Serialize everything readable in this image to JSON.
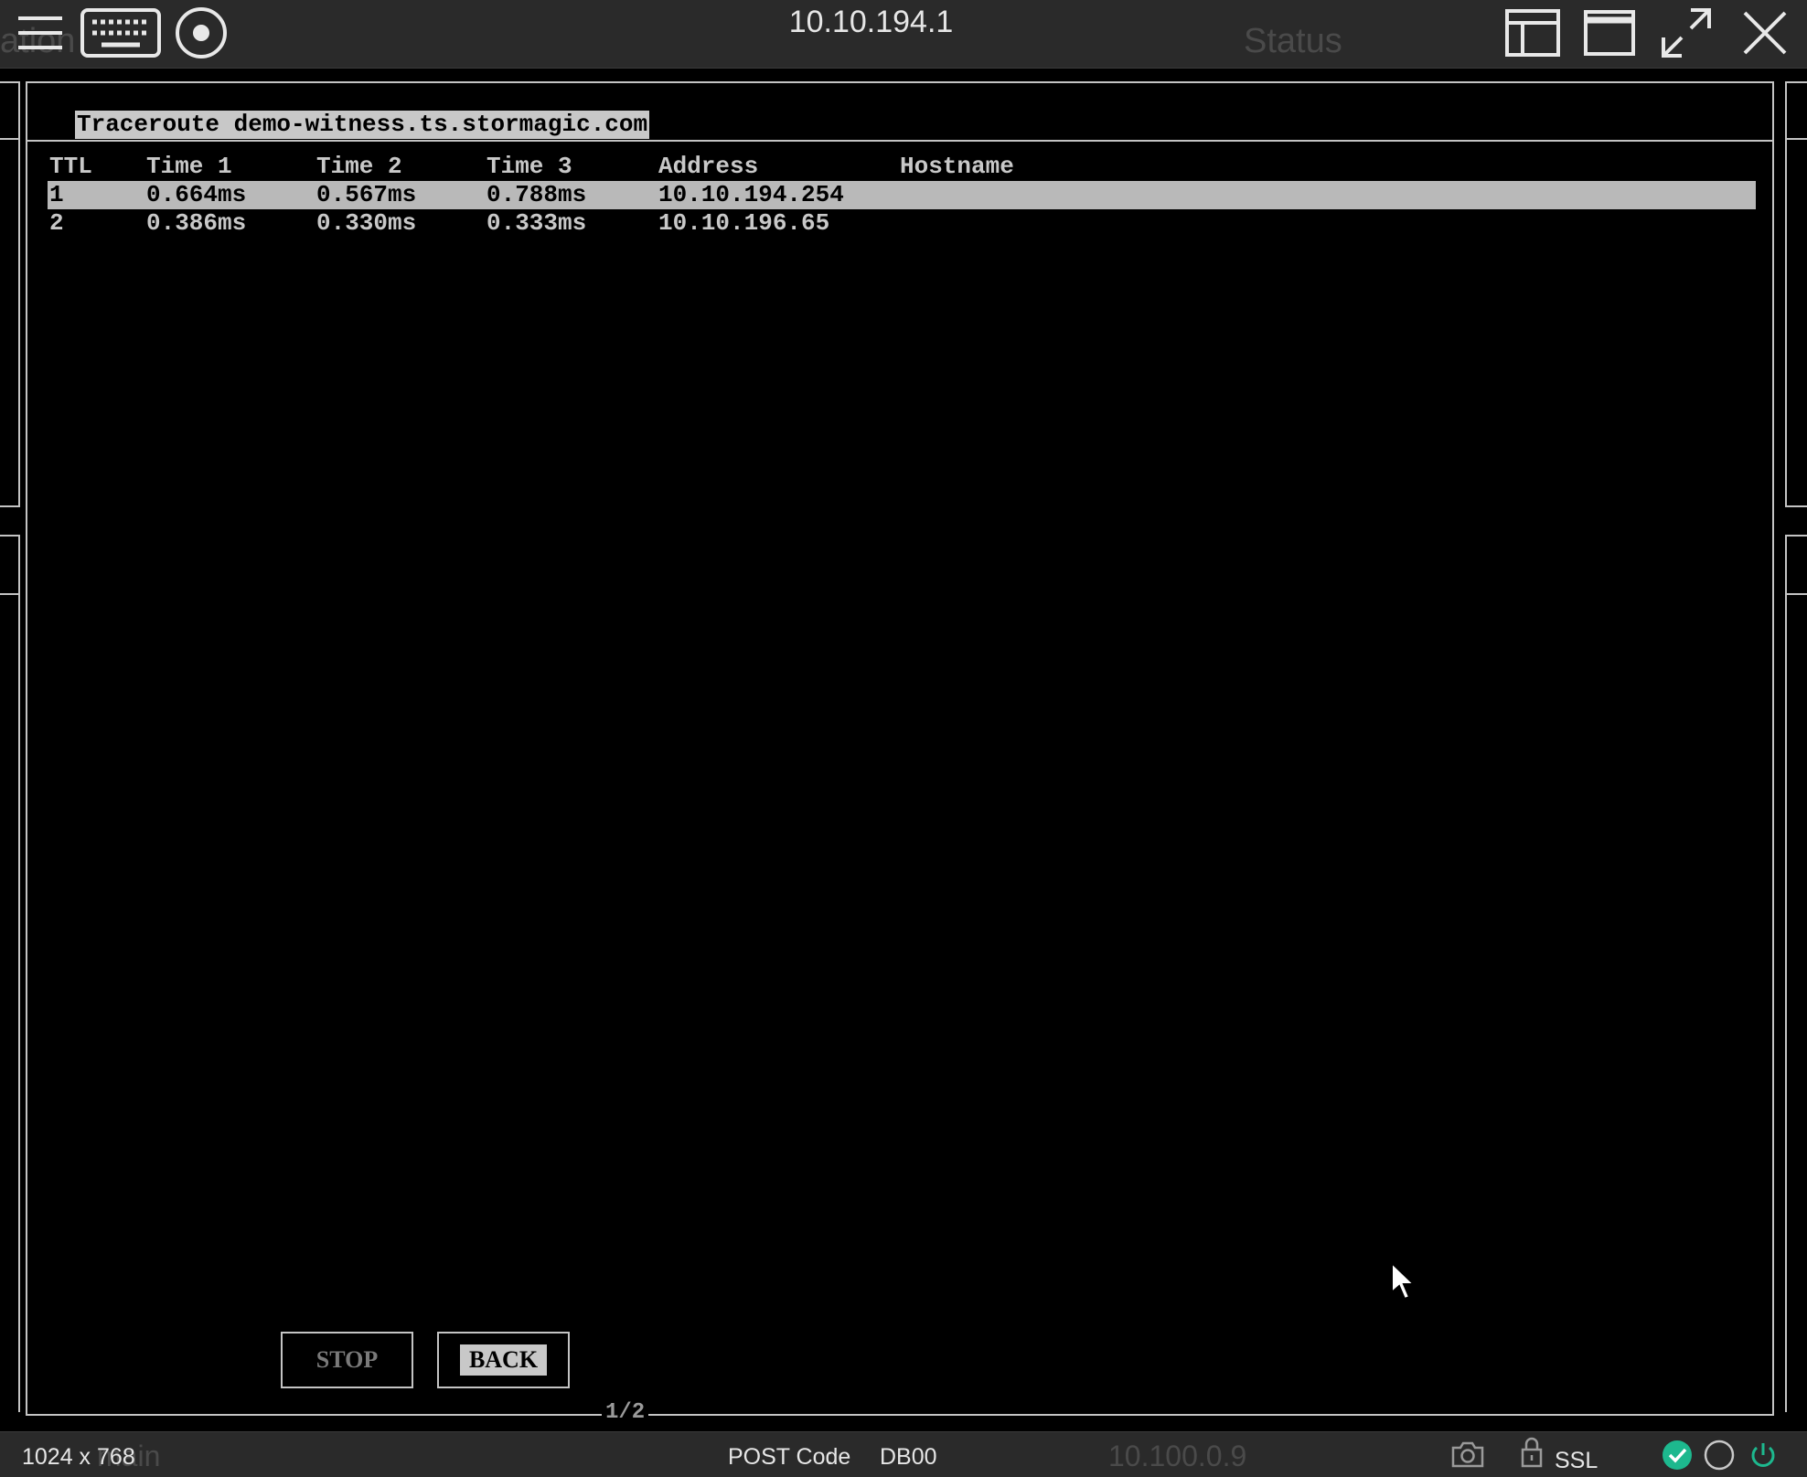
{
  "viewer": {
    "title": "10.10.194.1",
    "background_text_left": "ation",
    "background_text_right": "Status",
    "toolbar_icons": [
      "hamburger-menu-icon",
      "keyboard-icon",
      "media-disc-icon",
      "layout-icon",
      "window-icon",
      "fullscreen-icon",
      "close-icon"
    ]
  },
  "console": {
    "panel_title": "Traceroute demo-witness.ts.stormagic.com",
    "columns": [
      "TTL",
      "Time 1",
      "Time 2",
      "Time 3",
      "Address",
      "Hostname"
    ],
    "rows": [
      {
        "ttl": "1",
        "time1": "0.664ms",
        "time2": "0.567ms",
        "time3": "0.788ms",
        "address": "10.10.194.254",
        "hostname": "",
        "selected": true
      },
      {
        "ttl": "2",
        "time1": "0.386ms",
        "time2": "0.330ms",
        "time3": "0.333ms",
        "address": "10.10.196.65",
        "hostname": "",
        "selected": false
      }
    ],
    "buttons": {
      "stop": "STOP",
      "back": "BACK"
    },
    "page_indicator": "1/2"
  },
  "status": {
    "resolution": "1024 x 768",
    "background_text_left": "main",
    "post_code_label": "POST Code",
    "post_code_separator": ":",
    "post_code_value": "DB00",
    "background_ip": "10.100.0.9",
    "ssl_label": "SSL",
    "colors": {
      "ok": "#1db88e",
      "power": "#1db88e"
    }
  }
}
